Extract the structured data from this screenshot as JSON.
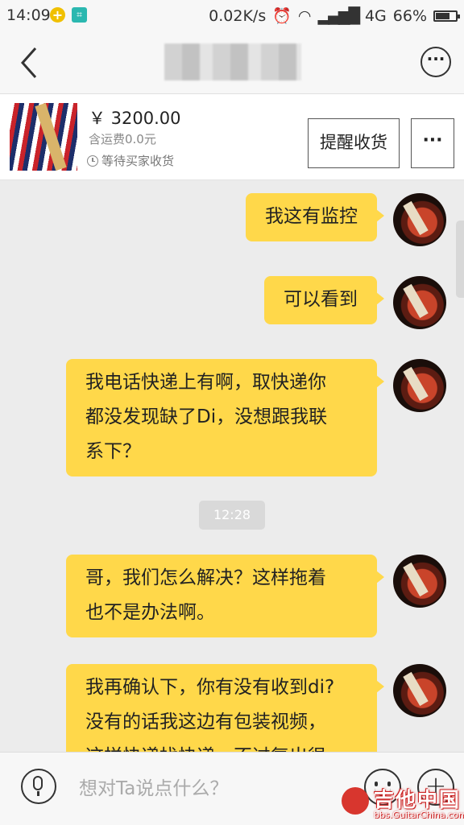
{
  "status_bar": {
    "time": "14:09",
    "speed": "0.02K/s",
    "network": "4G",
    "battery": "66%",
    "battery_level": 0.66
  },
  "header": {
    "title": ""
  },
  "product": {
    "price": "￥ 3200.00",
    "shipping": "含运费0.0元",
    "status": "等待买家收货",
    "remind_label": "提醒收货",
    "more_label": "···"
  },
  "messages": [
    {
      "text": "我这有监控"
    },
    {
      "text": "可以看到"
    },
    {
      "text": "我电话快递上有啊，取快递你\n都没发现缺了Di，没想跟我联\n系下？"
    },
    {
      "text": "哥，我们怎么解决？这样拖着\n也不是办法啊。"
    },
    {
      "text": "我再确认下，你有没有收到di?\n没有的话我这边有包装视频，\n这样快递找快递，不过复出很"
    }
  ],
  "timestamp": "12:28",
  "input": {
    "placeholder": "想对Ta说点什么？"
  },
  "watermark": {
    "title": "吉他中国",
    "url": "bbs.GuitarChina.com"
  },
  "colors": {
    "bubble": "#ffd84a",
    "background": "#ececec"
  }
}
